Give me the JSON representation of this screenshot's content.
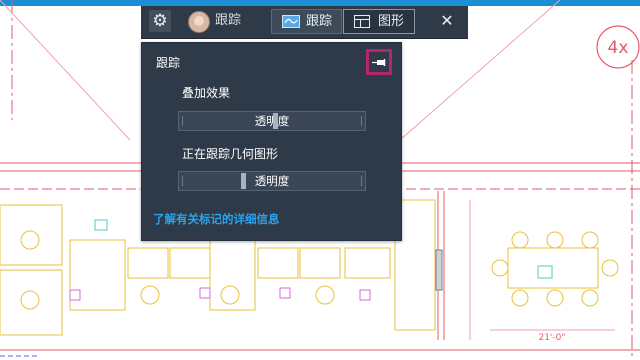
{
  "toolbar": {
    "settings_icon": "gear-icon",
    "user_label": "跟踪",
    "tabs": [
      {
        "label": "跟踪",
        "icon": "trace-icon",
        "active": true
      },
      {
        "label": "图形",
        "icon": "shape-icon",
        "active": false
      }
    ],
    "close_icon": "close-icon",
    "close_label": "✕"
  },
  "panel": {
    "title": "跟踪",
    "pin_icon": "pin-icon",
    "overlay": {
      "label": "叠加效果",
      "slider_label": "透明度",
      "value_fraction": 0.52
    },
    "tracing": {
      "label": "正在跟踪几何图形",
      "slider_label": "透明度",
      "value_fraction": 0.34
    },
    "link_text": "了解有关标记的详细信息"
  },
  "drawing": {
    "marker_text": "4x",
    "dimension_text": "21'-0\""
  },
  "colors": {
    "top_bar": "#1b8fd6",
    "panel_bg": "#2f3a48",
    "highlight_border": "#b7256d",
    "link": "#2aa3ec"
  }
}
